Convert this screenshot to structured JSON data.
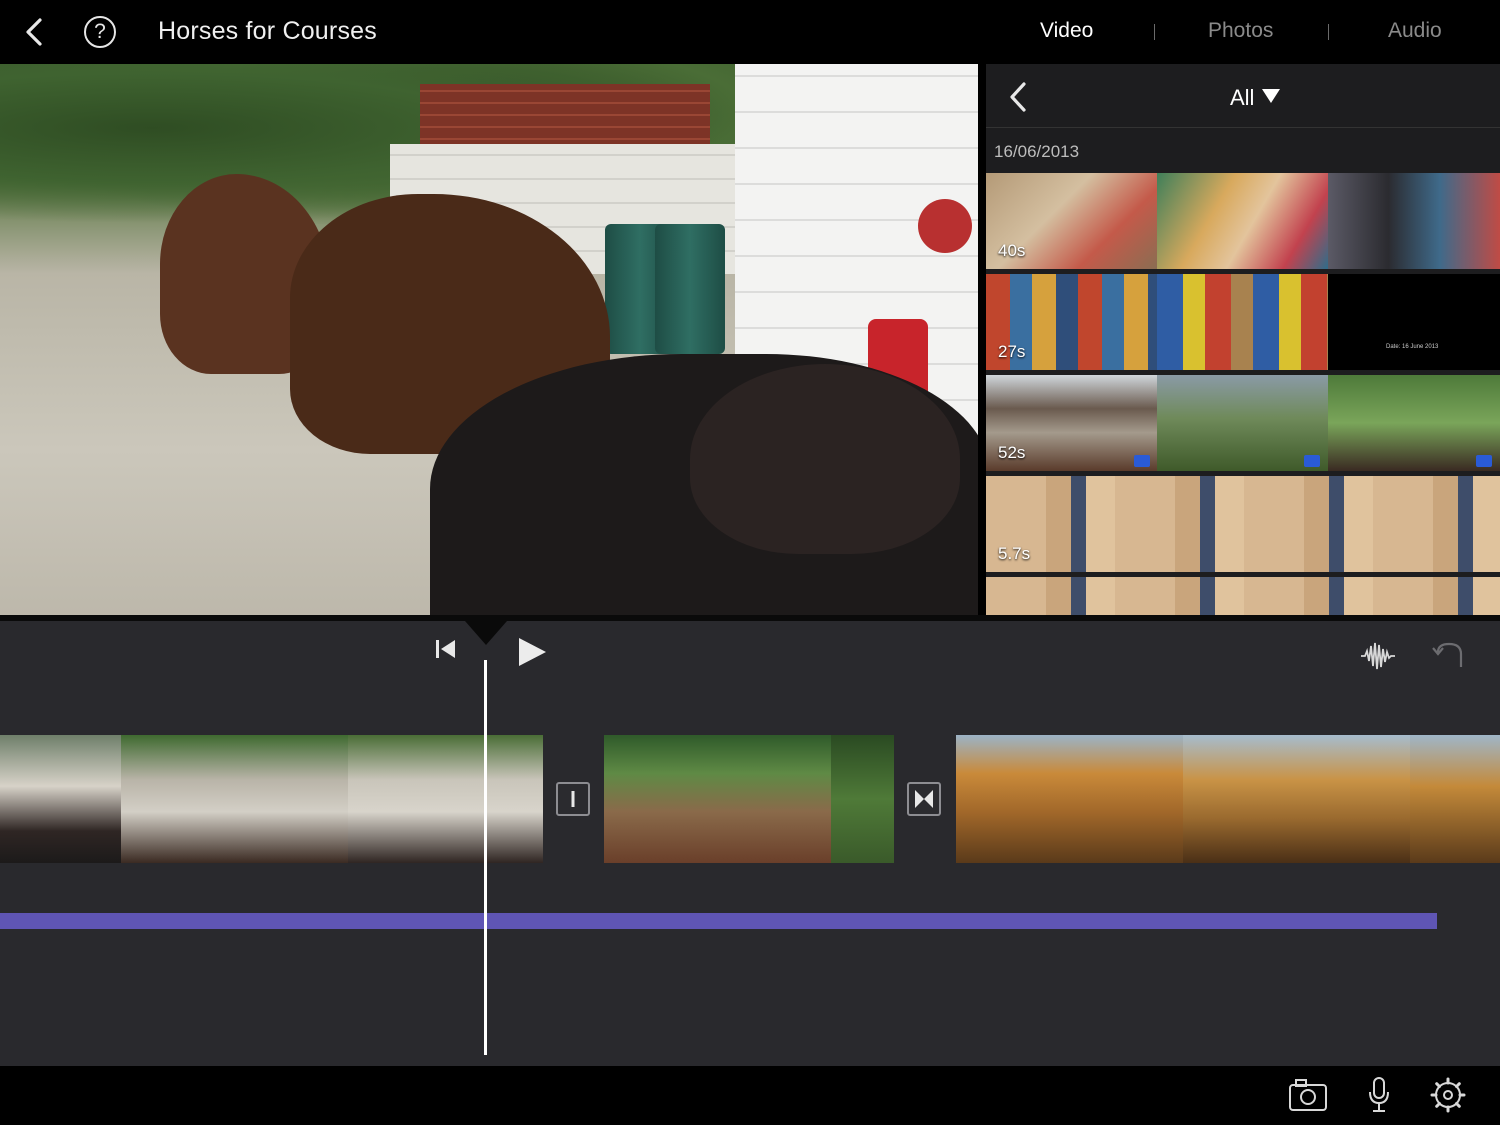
{
  "header": {
    "project_title": "Horses for Courses",
    "tabs": [
      {
        "label": "Video",
        "active": true
      },
      {
        "label": "Photos",
        "active": false
      },
      {
        "label": "Audio",
        "active": false
      }
    ]
  },
  "browser": {
    "filter_label": "All",
    "date_group": "16/06/2013",
    "clips": [
      {
        "duration": "40s"
      },
      {
        "duration": "27s"
      },
      {
        "duration": "52s"
      },
      {
        "duration": "5.7s"
      }
    ],
    "title_card_text": "Date: 16 June 2013"
  },
  "icons": {
    "back": "chevron-left-icon",
    "help": "question-circle-icon",
    "filter_caret": "triangle-down-icon",
    "rewind": "skip-back-icon",
    "play": "play-icon",
    "waveform": "waveform-icon",
    "undo": "undo-icon",
    "transition_cut": "transition-none-icon",
    "transition_cross": "transition-cross-dissolve-icon",
    "camera": "camera-icon",
    "microphone": "microphone-icon",
    "settings": "gear-icon"
  },
  "colors": {
    "background": "#000000",
    "timeline_bg": "#29292d",
    "browser_bg": "#1d1d1f",
    "audio_track": "#5f55b4",
    "active_tab": "#ffffff",
    "inactive_tab": "#8a8a8a"
  },
  "help_glyph": "?"
}
